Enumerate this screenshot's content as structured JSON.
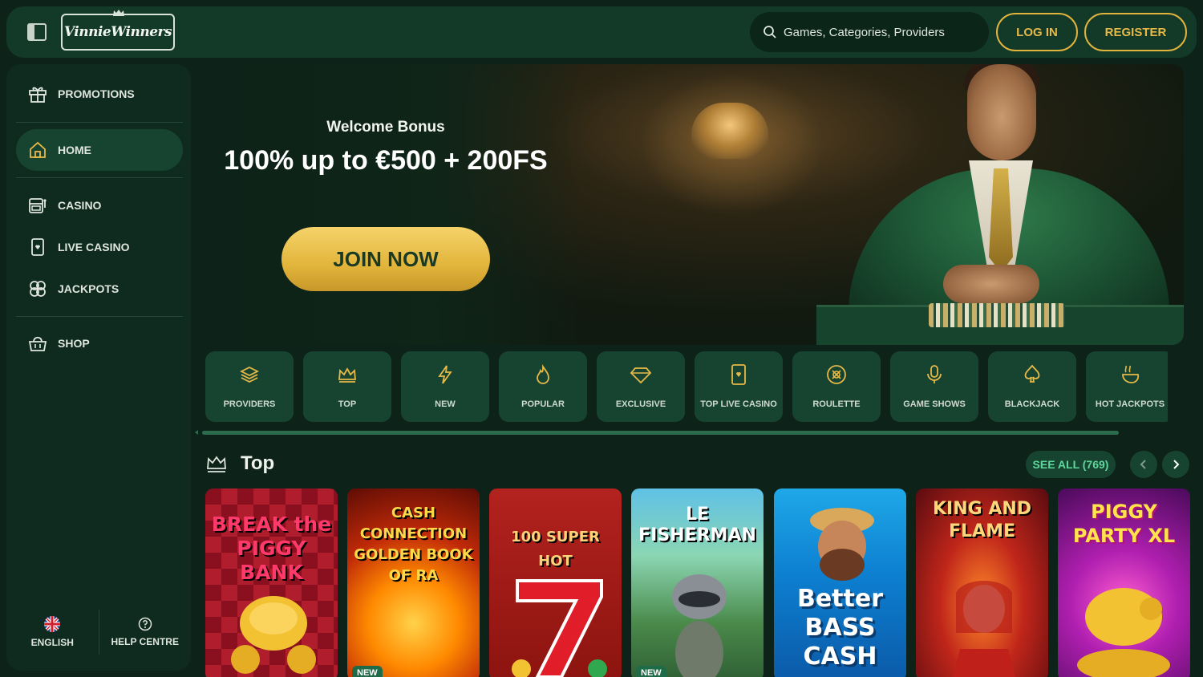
{
  "header": {
    "logo_text": "VinnieWinners",
    "search_placeholder": "Games, Categories, Providers",
    "login_label": "LOG IN",
    "register_label": "REGISTER"
  },
  "sidebar": {
    "items": [
      {
        "label": "PROMOTIONS",
        "icon": "gift-icon"
      },
      {
        "label": "HOME",
        "icon": "home-icon",
        "active": true
      },
      {
        "label": "CASINO",
        "icon": "slot-machine-icon"
      },
      {
        "label": "LIVE CASINO",
        "icon": "card-icon"
      },
      {
        "label": "JACKPOTS",
        "icon": "clover-icon"
      },
      {
        "label": "SHOP",
        "icon": "basket-icon"
      }
    ],
    "footer": {
      "language_label": "ENGLISH",
      "help_label": "HELP CENTRE"
    }
  },
  "hero": {
    "subtitle": "Welcome Bonus",
    "title": "100% up to €500 + 200FS",
    "cta_label": "JOIN NOW"
  },
  "categories": [
    {
      "label": "PROVIDERS",
      "icon": "layers-icon"
    },
    {
      "label": "TOP",
      "icon": "crown-icon"
    },
    {
      "label": "NEW",
      "icon": "lightning-icon"
    },
    {
      "label": "POPULAR",
      "icon": "flame-icon"
    },
    {
      "label": "EXCLUSIVE",
      "icon": "diamond-icon"
    },
    {
      "label": "TOP LIVE CASINO",
      "icon": "card-icon"
    },
    {
      "label": "ROULETTE",
      "icon": "roulette-icon"
    },
    {
      "label": "GAME SHOWS",
      "icon": "microphone-icon"
    },
    {
      "label": "BLACKJACK",
      "icon": "spade-icon"
    },
    {
      "label": "HOT JACKPOTS",
      "icon": "hot-pot-icon"
    }
  ],
  "section": {
    "title": "Top",
    "see_all_label": "SEE ALL (769)"
  },
  "games": [
    {
      "name": "BREAK the PIGGY BANK",
      "badge": ""
    },
    {
      "name": "CASH CONNECTION GOLDEN BOOK OF RA",
      "badge": "NEW"
    },
    {
      "name": "100 SUPER HOT",
      "badge": ""
    },
    {
      "name": "LE FISHERMAN",
      "badge": "NEW"
    },
    {
      "name": "Better BASS CASH",
      "badge": ""
    },
    {
      "name": "KING AND FLAME",
      "badge": ""
    },
    {
      "name": "PIGGY PARTY XL",
      "badge": ""
    }
  ],
  "colors": {
    "accent_gold": "#e7b947",
    "accent_green": "#5fd89c",
    "background": "#0d2218",
    "panel": "#133a29"
  }
}
